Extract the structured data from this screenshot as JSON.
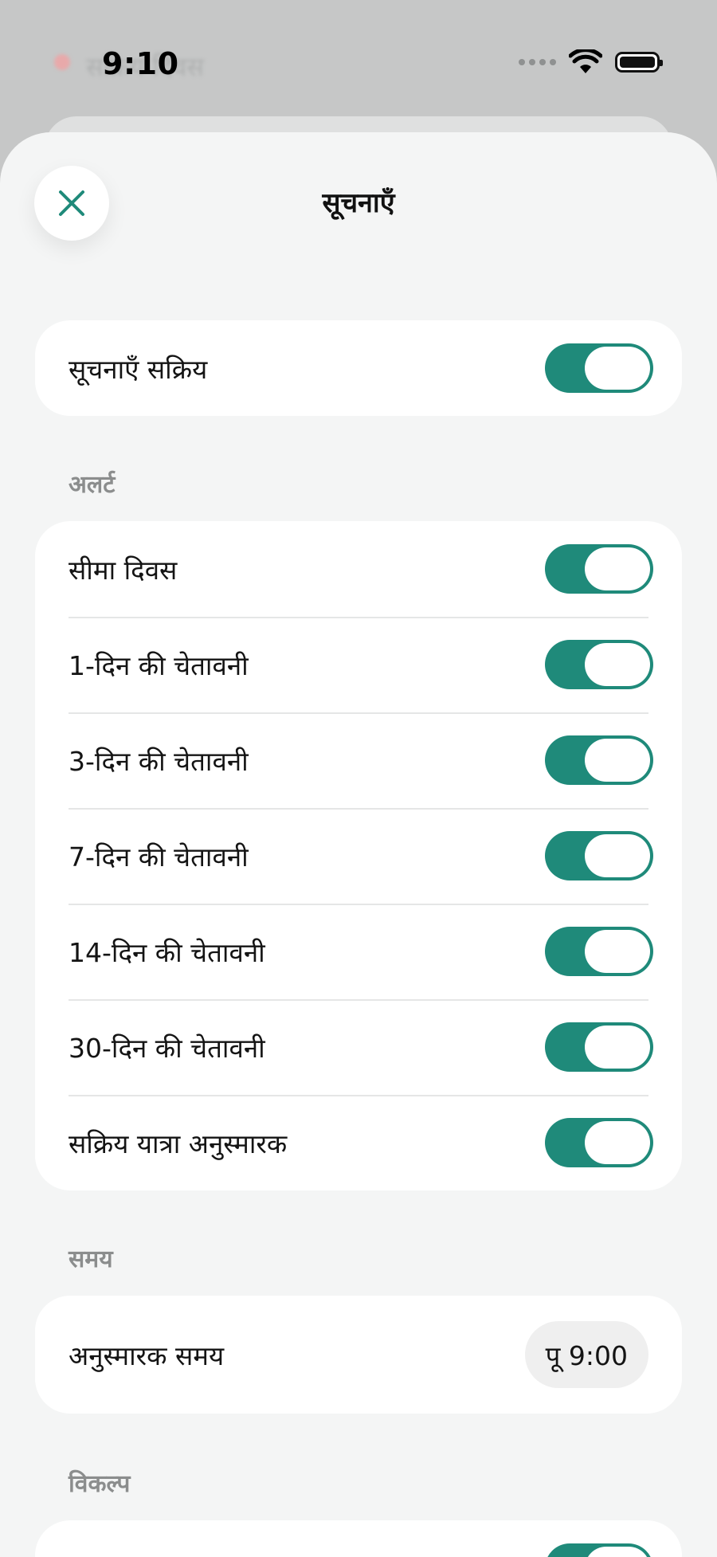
{
  "status": {
    "time": "9:10",
    "bg_text": "सक्रिय दिवस"
  },
  "sheet": {
    "title": "सूचनाएँ"
  },
  "master": {
    "label": "सूचनाएँ सक्रिय",
    "on": true
  },
  "alerts": {
    "heading": "अलर्ट",
    "items": [
      {
        "label": "सीमा दिवस",
        "on": true
      },
      {
        "label": "1-दिन की चेतावनी",
        "on": true
      },
      {
        "label": "3-दिन की चेतावनी",
        "on": true
      },
      {
        "label": "7-दिन की चेतावनी",
        "on": true
      },
      {
        "label": "14-दिन की चेतावनी",
        "on": true
      },
      {
        "label": "30-दिन की चेतावनी",
        "on": true
      },
      {
        "label": "सक्रिय यात्रा अनुस्मारक",
        "on": true
      }
    ]
  },
  "timing": {
    "heading": "समय",
    "label": "अनुस्मारक समय",
    "value": "पू 9:00"
  },
  "options": {
    "heading": "विकल्प"
  },
  "colors": {
    "accent": "#1f8a7a"
  }
}
